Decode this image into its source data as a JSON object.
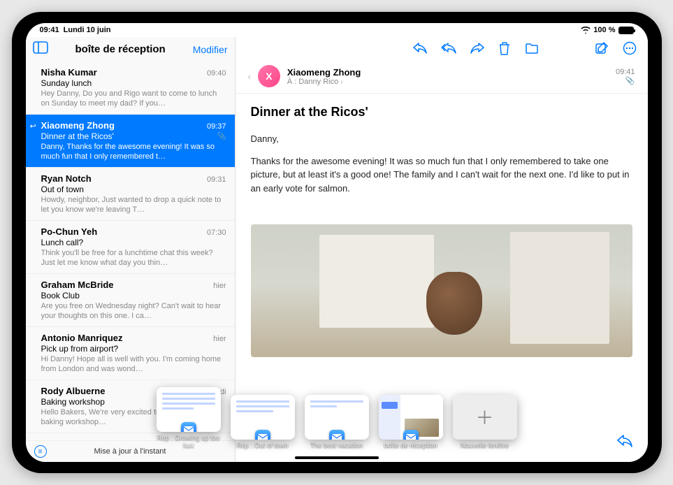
{
  "status": {
    "time": "09:41",
    "date": "Lundi 10 juin",
    "battery": "100 %"
  },
  "sidebar": {
    "title": "boîte de réception",
    "edit": "Modifier",
    "footer": "Mise à jour à l'instant"
  },
  "messages": [
    {
      "sender": "Nisha Kumar",
      "time": "09:40",
      "subject": "Sunday lunch",
      "preview": "Hey Danny, Do you and Rigo want to come to lunch on Sunday to meet my dad? If you…"
    },
    {
      "sender": "Xiaomeng Zhong",
      "time": "09:37",
      "subject": "Dinner at the Ricos'",
      "preview": "Danny, Thanks for the awesome evening! It was so much fun that I only remembered t…"
    },
    {
      "sender": "Ryan Notch",
      "time": "09:31",
      "subject": "Out of town",
      "preview": "Howdy, neighbor, Just wanted to drop a quick note to let you know we're leaving T…"
    },
    {
      "sender": "Po-Chun Yeh",
      "time": "07:30",
      "subject": "Lunch call?",
      "preview": "Think you'll be free for a lunchtime chat this week? Just let me know what day you thin…"
    },
    {
      "sender": "Graham McBride",
      "time": "hier",
      "subject": "Book Club",
      "preview": "Are you free on Wednesday night? Can't wait to hear your thoughts on this one. I ca…"
    },
    {
      "sender": "Antonio Manriquez",
      "time": "hier",
      "subject": "Pick up from airport?",
      "preview": "Hi Danny! Hope all is well with you. I'm coming home from London and was wond…"
    },
    {
      "sender": "Rody Albuerne",
      "time": "samedi",
      "subject": "Baking workshop",
      "preview": "Hello Bakers, We're very excited to all join us for our baking workshop…"
    }
  ],
  "reader": {
    "from": "Xiaomeng Zhong",
    "to_label": "À :",
    "to_name": "Danny Rico",
    "time": "09:41",
    "subject": "Dinner at the Ricos'",
    "greeting": "Danny,",
    "body": "Thanks for the awesome evening! It was so much fun that I only remembered to take one picture, but at least it's a good one! The family and I can't wait for the next one. I'd like to put in an early vote for salmon."
  },
  "shelf": [
    {
      "label": "Rép : Growing up too fast"
    },
    {
      "label": "Rép : Out of town"
    },
    {
      "label": "The best vacation"
    },
    {
      "label": "boîte de réception"
    },
    {
      "label": "Nouvelle fenêtre"
    }
  ]
}
